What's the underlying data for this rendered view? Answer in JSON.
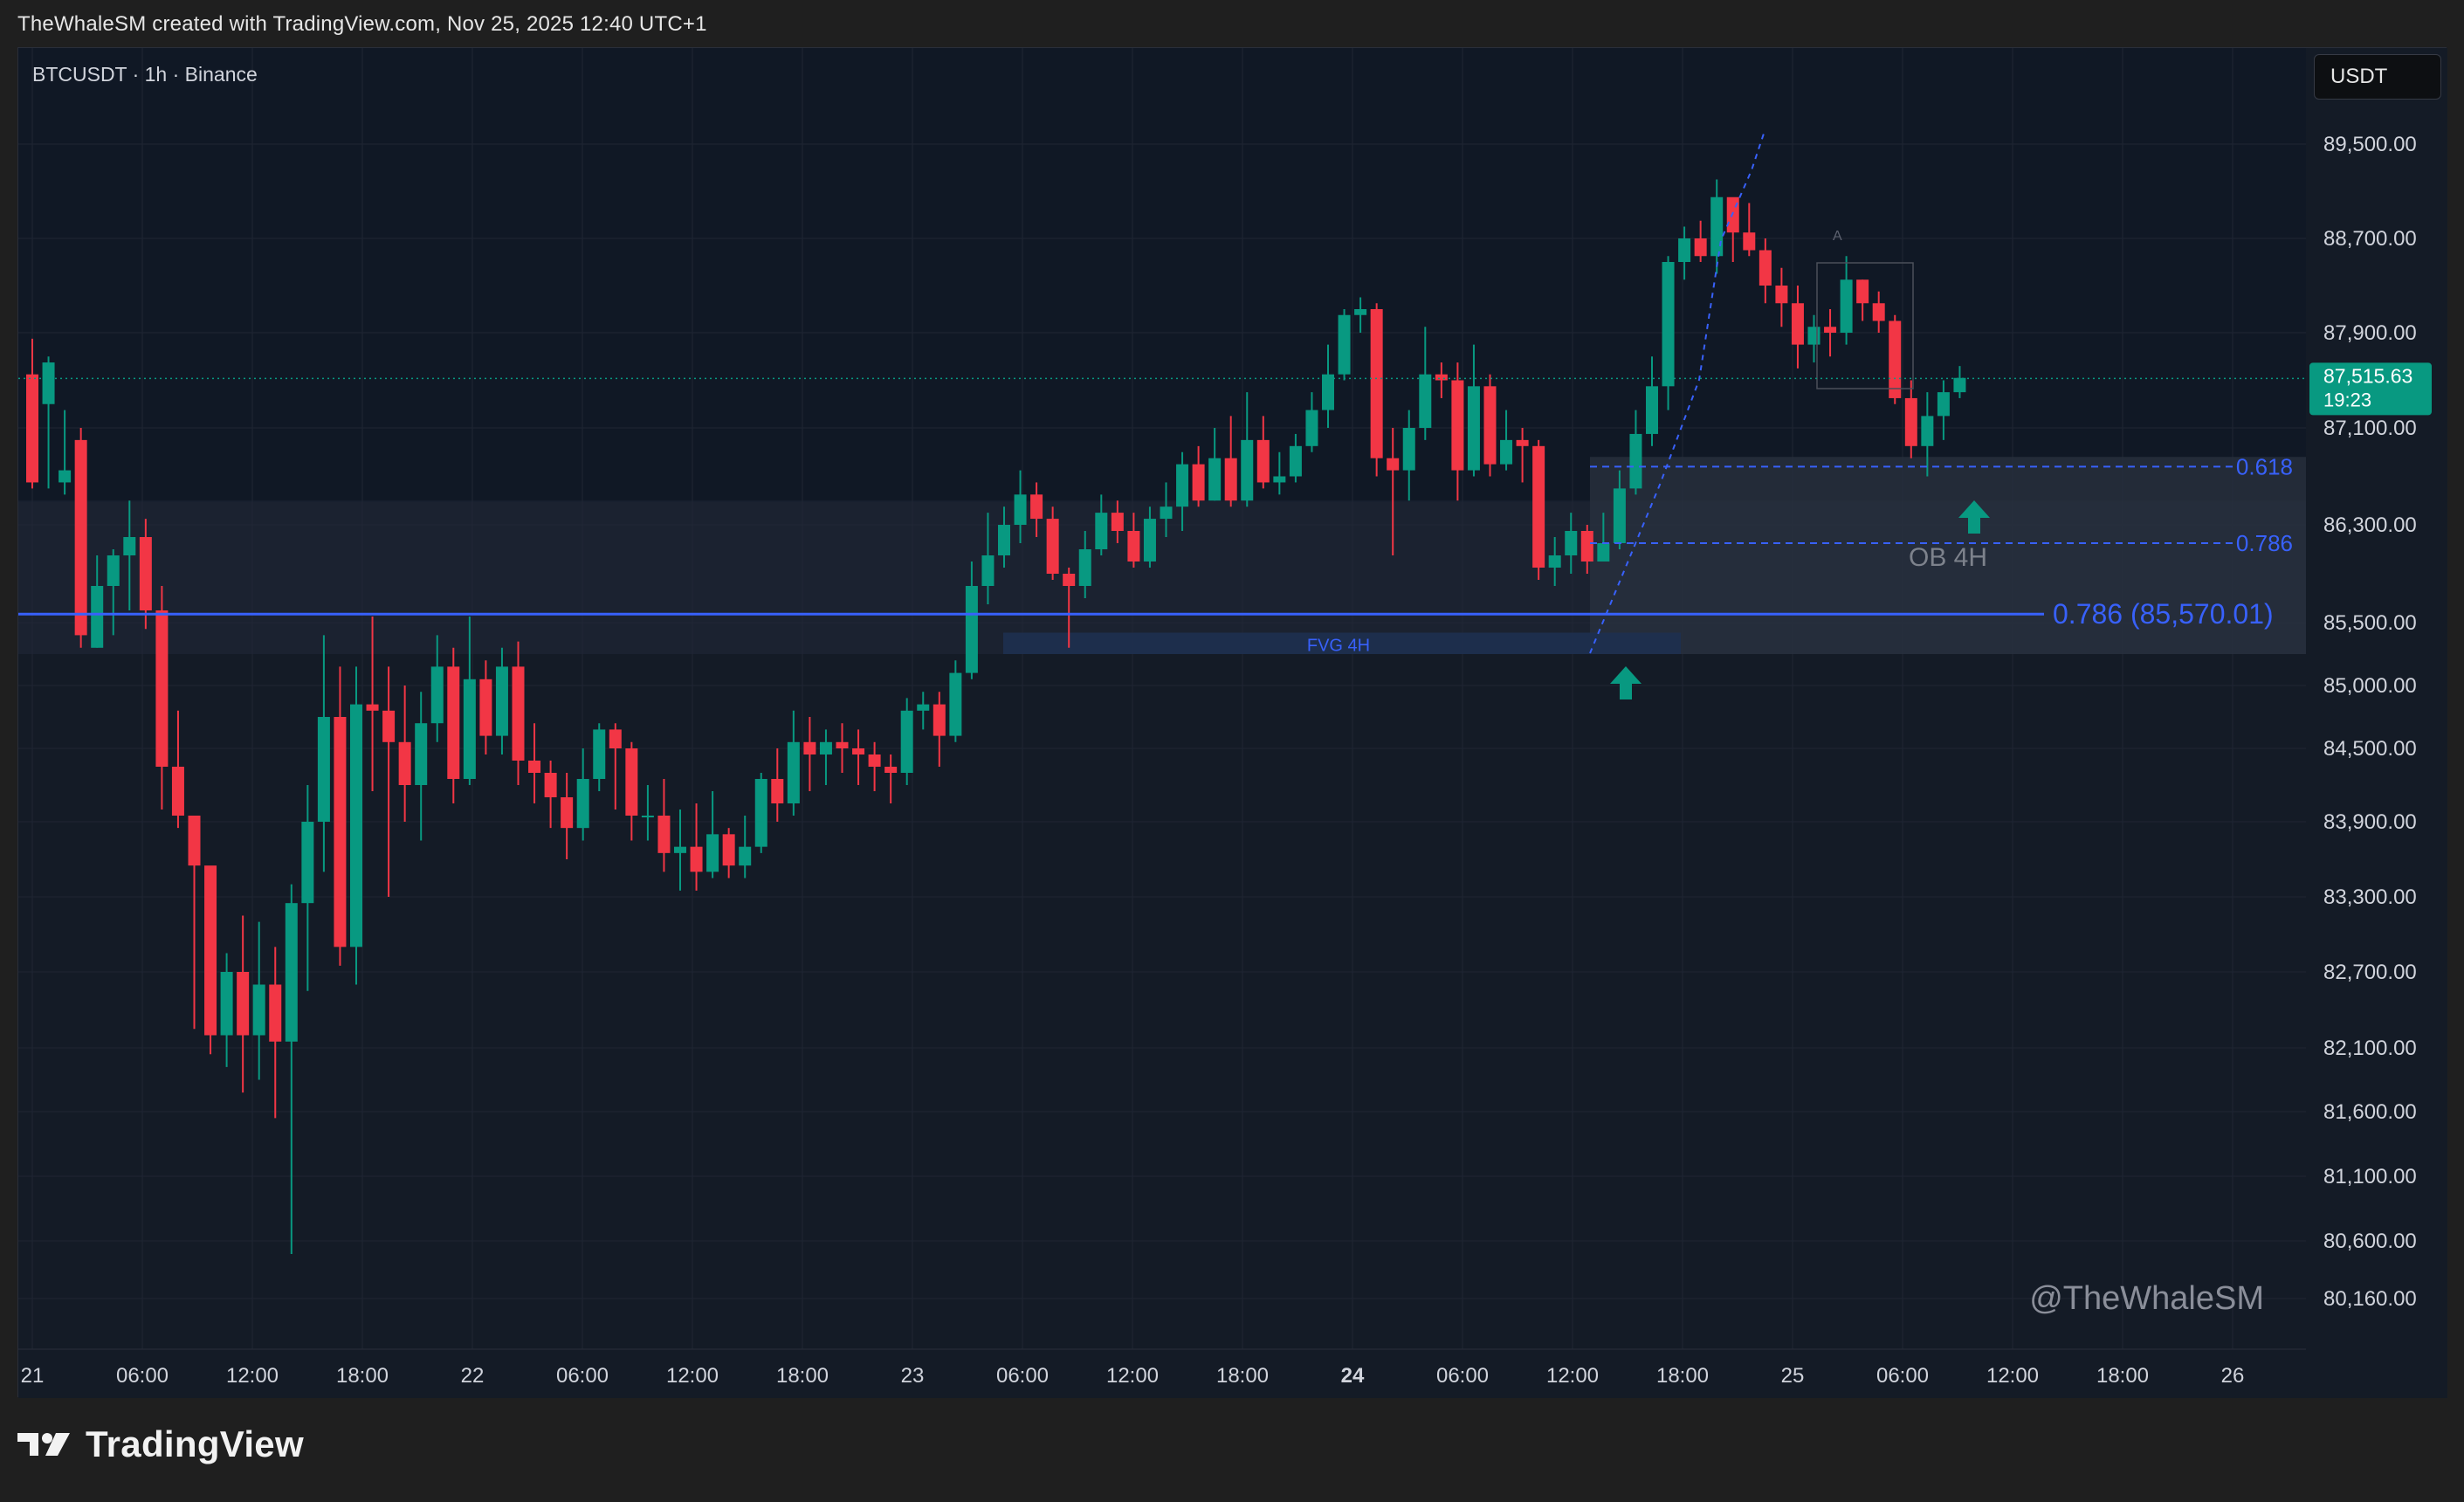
{
  "header": {
    "credit": "TheWhaleSM created with TradingView.com, Nov 25, 2025 12:40 UTC+1"
  },
  "symbol_label": "BTCUSDT · 1h · Binance",
  "currency_button": "USDT",
  "watermark": "@TheWhaleSM",
  "logo": "TradingView",
  "colors": {
    "up": "#089981",
    "down": "#f23645",
    "fib_line": "#3861fb",
    "price_tag": "#089981",
    "background": "#141b26"
  },
  "current_price": {
    "value": "87,515.63",
    "countdown": "19:23"
  },
  "annotations": {
    "fib_0618": "0.618",
    "fib_0786": "0.786",
    "fib_main": "0.786 (85,570.01)",
    "ob_label": "OB 4H",
    "fvg_label": "FVG 4H",
    "box_marker": "A"
  },
  "chart_data": {
    "type": "candlestick",
    "symbol": "BTCUSDT",
    "timeframe": "1h",
    "exchange": "Binance",
    "y_tick_labels": [
      "89,500.00",
      "88,700.00",
      "87,900.00",
      "87,100.00",
      "86,300.00",
      "85,500.00",
      "85,000.00",
      "84,500.00",
      "83,900.00",
      "83,300.00",
      "82,700.00",
      "82,100.00",
      "81,600.00",
      "81,100.00",
      "80,600.00",
      "80,160.00"
    ],
    "y_tick_values": [
      89500,
      88700,
      87900,
      87100,
      86300,
      85500,
      85000,
      84500,
      83900,
      83300,
      82700,
      82100,
      81600,
      81100,
      80600,
      80160
    ],
    "x_tick_labels": [
      "21",
      "06:00",
      "12:00",
      "18:00",
      "22",
      "06:00",
      "12:00",
      "18:00",
      "23",
      "06:00",
      "12:00",
      "18:00",
      "24",
      "06:00",
      "12:00",
      "18:00",
      "25",
      "06:00",
      "12:00",
      "18:00",
      "26"
    ],
    "levels": {
      "fib_0618": 86780,
      "fib_0786_short": 86150,
      "fib_0786_main": 85570.01,
      "current_price": 87515.63
    },
    "zones": {
      "ob_4h": [
        85250,
        86500
      ],
      "fvg_4h": [
        85250,
        85420
      ]
    },
    "candles": [
      [
        87550,
        87300,
        86650,
        87850,
        86600
      ],
      [
        87300,
        86650,
        87650,
        87700,
        86600
      ],
      [
        86650,
        87000,
        86750,
        87250,
        86550
      ],
      [
        87000,
        86900,
        85400,
        87100,
        85300
      ],
      [
        85300,
        85350,
        85800,
        86050,
        85300
      ],
      [
        85800,
        85750,
        86050,
        86100,
        85400
      ],
      [
        86050,
        86000,
        86200,
        86500,
        85600
      ],
      [
        86200,
        86250,
        85600,
        86350,
        85450
      ],
      [
        85600,
        85550,
        84350,
        85800,
        84000
      ],
      [
        84350,
        84400,
        83950,
        84800,
        83850
      ],
      [
        83950,
        83700,
        83550,
        83900,
        82250
      ],
      [
        83550,
        83300,
        82200,
        83400,
        82050
      ],
      [
        82200,
        82350,
        82700,
        82850,
        81950
      ],
      [
        82700,
        82600,
        82200,
        83150,
        81750
      ],
      [
        82200,
        82350,
        82600,
        83100,
        81850
      ],
      [
        82600,
        82350,
        82150,
        82900,
        81550
      ],
      [
        82150,
        82500,
        83250,
        83400,
        80500
      ],
      [
        83250,
        83200,
        83900,
        84200,
        82550
      ],
      [
        83900,
        84000,
        84750,
        85400,
        83500
      ],
      [
        84750,
        84850,
        82900,
        85150,
        82750
      ],
      [
        82900,
        83000,
        84850,
        85150,
        82600
      ],
      [
        84850,
        84900,
        84800,
        85550,
        84150
      ],
      [
        84800,
        84750,
        84550,
        85150,
        83300
      ],
      [
        84550,
        84500,
        84200,
        85000,
        83900
      ],
      [
        84200,
        84350,
        84700,
        84950,
        83750
      ],
      [
        84700,
        84750,
        85150,
        85400,
        84550
      ],
      [
        85150,
        85050,
        84250,
        85300,
        84050
      ],
      [
        84250,
        84300,
        85050,
        85550,
        84200
      ],
      [
        85050,
        84950,
        84600,
        85200,
        84450
      ],
      [
        84600,
        84750,
        85150,
        85300,
        84450
      ],
      [
        85150,
        85000,
        84400,
        85350,
        84200
      ],
      [
        84400,
        84350,
        84300,
        84700,
        84050
      ],
      [
        84300,
        84200,
        84100,
        84400,
        83850
      ],
      [
        84100,
        84200,
        83850,
        84300,
        83600
      ],
      [
        83850,
        83950,
        84250,
        84500,
        83750
      ],
      [
        84250,
        84350,
        84650,
        84700,
        84150
      ],
      [
        84650,
        84600,
        84500,
        84700,
        84000
      ],
      [
        84500,
        84450,
        83950,
        84550,
        83750
      ],
      [
        83950,
        84000,
        83950,
        84200,
        83750
      ],
      [
        83950,
        83900,
        83650,
        84250,
        83500
      ],
      [
        83650,
        83600,
        83700,
        84000,
        83350
      ],
      [
        83700,
        83650,
        83500,
        84050,
        83350
      ],
      [
        83500,
        83600,
        83800,
        84150,
        83450
      ],
      [
        83800,
        83750,
        83550,
        83850,
        83450
      ],
      [
        83550,
        83650,
        83700,
        83950,
        83450
      ],
      [
        83700,
        83800,
        84250,
        84300,
        83650
      ],
      [
        84250,
        84200,
        84050,
        84500,
        83900
      ],
      [
        84050,
        84200,
        84550,
        84800,
        83950
      ],
      [
        84550,
        84600,
        84450,
        84750,
        84150
      ],
      [
        84450,
        84500,
        84550,
        84650,
        84200
      ],
      [
        84550,
        84600,
        84500,
        84700,
        84300
      ],
      [
        84500,
        84550,
        84450,
        84650,
        84200
      ],
      [
        84450,
        84500,
        84350,
        84550,
        84150
      ],
      [
        84350,
        84400,
        84300,
        84450,
        84050
      ],
      [
        84300,
        84250,
        84800,
        84900,
        84200
      ],
      [
        84800,
        84850,
        84850,
        84950,
        84650
      ],
      [
        84850,
        84900,
        84600,
        84950,
        84350
      ],
      [
        84600,
        84650,
        85100,
        85200,
        84550
      ],
      [
        85100,
        85150,
        85800,
        86000,
        85050
      ],
      [
        85800,
        85850,
        86050,
        86400,
        85650
      ],
      [
        86050,
        86100,
        86300,
        86450,
        85950
      ],
      [
        86300,
        86350,
        86550,
        86750,
        86150
      ],
      [
        86550,
        86600,
        86350,
        86650,
        86200
      ],
      [
        86350,
        86300,
        85900,
        86450,
        85850
      ],
      [
        85900,
        85850,
        85800,
        85950,
        85300
      ],
      [
        85800,
        85750,
        86100,
        86250,
        85700
      ],
      [
        86100,
        86150,
        86400,
        86550,
        86050
      ],
      [
        86400,
        86450,
        86250,
        86500,
        86150
      ],
      [
        86250,
        86300,
        86000,
        86400,
        85950
      ],
      [
        86000,
        86050,
        86350,
        86450,
        85950
      ],
      [
        86350,
        86300,
        86450,
        86650,
        86200
      ],
      [
        86450,
        86500,
        86800,
        86900,
        86250
      ],
      [
        86800,
        86750,
        86500,
        86950,
        86450
      ],
      [
        86500,
        86550,
        86850,
        87100,
        86500
      ],
      [
        86850,
        86900,
        86500,
        87200,
        86450
      ],
      [
        86500,
        86550,
        87000,
        87400,
        86450
      ],
      [
        87000,
        86950,
        86650,
        87200,
        86600
      ],
      [
        86650,
        86700,
        86700,
        86900,
        86550
      ],
      [
        86700,
        86650,
        86950,
        87050,
        86650
      ],
      [
        86950,
        87000,
        87250,
        87400,
        86900
      ],
      [
        87250,
        87200,
        87550,
        87800,
        87100
      ],
      [
        87550,
        87600,
        88050,
        88100,
        87500
      ],
      [
        88050,
        88000,
        88100,
        88200,
        87900
      ],
      [
        88100,
        88000,
        86850,
        88150,
        86700
      ],
      [
        86850,
        86800,
        86750,
        87100,
        86050
      ],
      [
        86750,
        86800,
        87100,
        87250,
        86500
      ],
      [
        87100,
        87200,
        87550,
        87950,
        87000
      ],
      [
        87550,
        87500,
        87500,
        87650,
        87350
      ],
      [
        87500,
        87400,
        86750,
        87650,
        86500
      ],
      [
        86750,
        86850,
        87450,
        87800,
        86700
      ],
      [
        87450,
        87400,
        86800,
        87550,
        86700
      ],
      [
        86800,
        86850,
        87000,
        87250,
        86750
      ],
      [
        87000,
        86950,
        86950,
        87100,
        86650
      ],
      [
        86950,
        86900,
        85950,
        87000,
        85850
      ],
      [
        85950,
        86000,
        86050,
        86200,
        85800
      ],
      [
        86050,
        86100,
        86250,
        86400,
        85900
      ],
      [
        86250,
        86200,
        86000,
        86300,
        85900
      ],
      [
        86000,
        86050,
        86150,
        86400,
        86050
      ],
      [
        86150,
        86200,
        86600,
        86750,
        86100
      ],
      [
        86600,
        86650,
        87050,
        87250,
        86550
      ],
      [
        87050,
        87100,
        87450,
        87700,
        86950
      ],
      [
        87450,
        87500,
        88500,
        88550,
        87250
      ],
      [
        88500,
        88550,
        88700,
        88800,
        88350
      ],
      [
        88700,
        88650,
        88550,
        88850,
        88500
      ],
      [
        88550,
        88600,
        89050,
        89200,
        88400
      ],
      [
        89050,
        88950,
        88750,
        89000,
        88500
      ],
      [
        88750,
        88700,
        88600,
        89000,
        88550
      ],
      [
        88600,
        88550,
        88300,
        88700,
        88150
      ],
      [
        88300,
        88200,
        88150,
        88450,
        87950
      ],
      [
        88150,
        88100,
        87800,
        88300,
        87600
      ],
      [
        87800,
        87850,
        87950,
        88050,
        87650
      ],
      [
        87950,
        88000,
        87900,
        88100,
        87700
      ],
      [
        87900,
        87950,
        88350,
        88550,
        87800
      ],
      [
        88350,
        88300,
        88150,
        88350,
        88000
      ],
      [
        88150,
        88100,
        88000,
        88250,
        87900
      ],
      [
        88000,
        87950,
        87350,
        88050,
        87300
      ],
      [
        87350,
        87300,
        86950,
        87500,
        86850
      ],
      [
        86950,
        87000,
        87200,
        87400,
        86700
      ],
      [
        87200,
        87250,
        87400,
        87500,
        87000
      ],
      [
        87400,
        87450,
        87520,
        87620,
        87350
      ]
    ]
  }
}
